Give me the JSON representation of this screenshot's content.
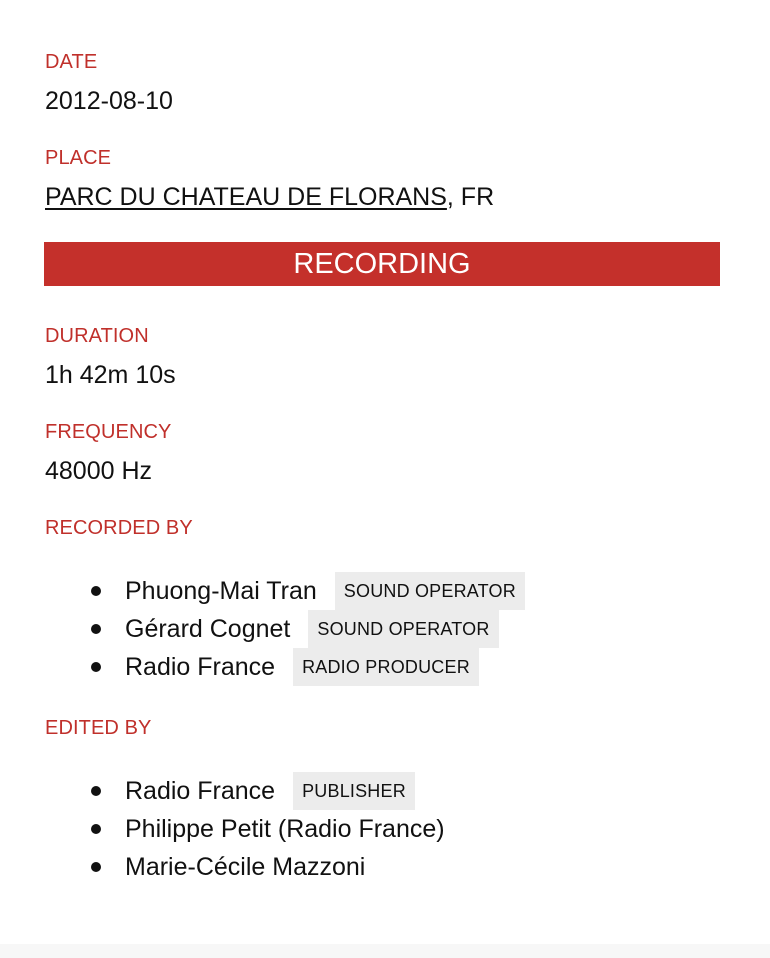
{
  "date": {
    "label": "DATE",
    "value": "2012-08-10"
  },
  "place": {
    "label": "PLACE",
    "link": "PARC DU CHATEAU DE FLORANS",
    "suffix": ", FR"
  },
  "recording_section": {
    "title": "RECORDING"
  },
  "duration": {
    "label": "DURATION",
    "value": "1h 42m 10s"
  },
  "frequency": {
    "label": "FREQUENCY",
    "value": "48000 Hz"
  },
  "recorded_by": {
    "label": "RECORDED BY",
    "people": [
      {
        "name": "Phuong-Mai Tran",
        "role": "SOUND OPERATOR"
      },
      {
        "name": "Gérard Cognet",
        "role": "SOUND OPERATOR"
      },
      {
        "name": "Radio France",
        "role": "RADIO PRODUCER"
      }
    ]
  },
  "edited_by": {
    "label": "EDITED BY",
    "people": [
      {
        "name": "Radio France",
        "role": "PUBLISHER"
      },
      {
        "name": "Philippe Petit (Radio France)"
      },
      {
        "name": "Marie-Cécile Mazzoni"
      }
    ]
  },
  "colors": {
    "accent": "#c4302b",
    "label_text": "#c0302b",
    "badge_bg": "#ececec",
    "text": "#111111"
  }
}
